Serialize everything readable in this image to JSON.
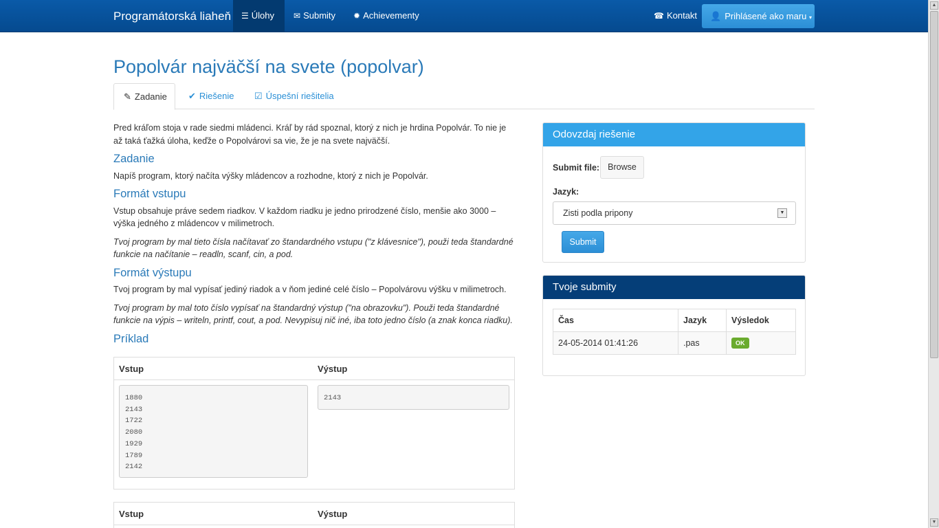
{
  "navbar": {
    "brand": "Programátorská liaheň",
    "items": [
      {
        "label": "Úlohy",
        "icon": "list-icon"
      },
      {
        "label": "Submity",
        "icon": "envelope-icon"
      },
      {
        "label": "Achievementy",
        "icon": "gear-icon"
      }
    ],
    "contact": "Kontakt",
    "user": "Prihlásené ako maru"
  },
  "page": {
    "title": "Popolvár najväčší na svete (popolvar)",
    "tabs": [
      "Zadanie",
      "Riešenie",
      "Úspešní riešitelia"
    ]
  },
  "task": {
    "intro": "Pred kráľom stoja v rade siedmi mládenci. Kráľ by rád spoznal, ktorý z nich je hrdina Popolvár. To nie je až taká ťažká úloha, keďže o Popolvárovi sa vie, že je na svete najväčší.",
    "h_zadanie": "Zadanie",
    "zadanie": "Napíš program, ktorý načíta výšky mládencov a rozhodne, ktorý z nich je Popolvár.",
    "h_vstup": "Formát vstupu",
    "vstup": "Vstup obsahuje práve sedem riadkov. V každom riadku je jedno prirodzené číslo, menšie ako 3000 – výška jedného z mládencov v milimetroch.",
    "vstup_note": "Tvoj program by mal tieto čísla načítavať zo štandardného vstupu (\"z klávesnice\"), použi teda štandardné funkcie na načítanie – readln, scanf, cin, a pod.",
    "h_vystup": "Formát výstupu",
    "vystup": "Tvoj program by mal vypísať jediný riadok a v ňom jediné celé číslo – Popolvárovu výšku v milimetroch.",
    "vystup_note": "Tvoj program by mal toto číslo vypísať na štandardný výstup (\"na obrazovku\"). Použi teda štandardné funkcie na výpis – writeln, printf, cout, a pod. Nevypisuj nič iné, iba toto jedno číslo (a znak konca riadku).",
    "h_priklad": "Príklad"
  },
  "example": {
    "col_in": "Vstup",
    "col_out": "Výstup",
    "input": "1880\n2143\n1722\n2080\n1929\n1789\n2142",
    "output": "2143"
  },
  "submit_panel": {
    "title": "Odovzdaj riešenie",
    "file_label": "Submit file:",
    "browse": "Browse",
    "lang_label": "Jazyk:",
    "lang_value": "Zisti podla pripony",
    "submit": "Submit"
  },
  "submissions": {
    "title": "Tvoje submity",
    "headers": [
      "Čas",
      "Jazyk",
      "Výsledok"
    ],
    "rows": [
      {
        "time": "24-05-2014 01:41:26",
        "lang": ".pas",
        "result": "OK"
      }
    ]
  }
}
